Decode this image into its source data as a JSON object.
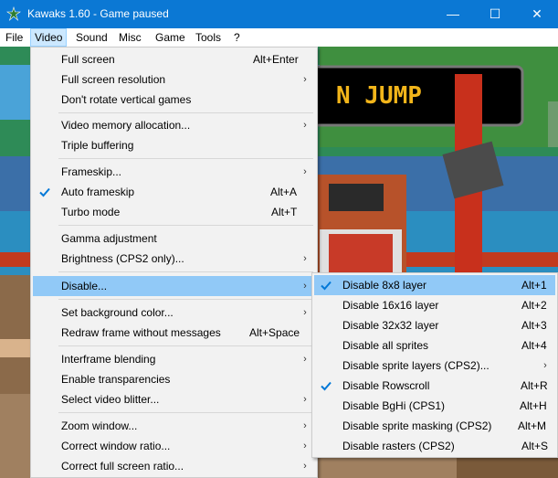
{
  "window": {
    "title": "Kawaks 1.60 - Game paused",
    "minimize_glyph": "—",
    "maximize_glyph": "☐",
    "close_glyph": "✕"
  },
  "menubar": [
    {
      "label": "File"
    },
    {
      "label": "Video"
    },
    {
      "label": "Sound"
    },
    {
      "label": "Misc"
    },
    {
      "label": "Game"
    },
    {
      "label": "Tools"
    },
    {
      "label": "?"
    }
  ],
  "game": {
    "banner_text": "N JUMP"
  },
  "video_menu": [
    {
      "label": "Full screen",
      "accel": "Alt+Enter"
    },
    {
      "label": "Full screen resolution",
      "submenu": true
    },
    {
      "label": "Don't rotate vertical games"
    },
    {
      "label": "Video memory allocation...",
      "submenu": true
    },
    {
      "label": "Triple buffering"
    },
    {
      "label": "Frameskip...",
      "submenu": true
    },
    {
      "label": "Auto frameskip",
      "accel": "Alt+A",
      "checked": true
    },
    {
      "label": "Turbo mode",
      "accel": "Alt+T"
    },
    {
      "label": "Gamma adjustment"
    },
    {
      "label": "Brightness (CPS2 only)...",
      "submenu": true
    },
    {
      "label": "Disable...",
      "submenu": true,
      "highlighted": true
    },
    {
      "label": "Set background color...",
      "submenu": true
    },
    {
      "label": "Redraw frame without messages",
      "accel": "Alt+Space"
    },
    {
      "label": "Interframe blending",
      "submenu": true
    },
    {
      "label": "Enable transparencies"
    },
    {
      "label": "Select video blitter...",
      "submenu": true
    },
    {
      "label": "Zoom window...",
      "submenu": true
    },
    {
      "label": "Correct window ratio...",
      "submenu": true
    },
    {
      "label": "Correct full screen ratio...",
      "submenu": true
    }
  ],
  "disable_menu": [
    {
      "label": "Disable 8x8 layer",
      "accel": "Alt+1",
      "checked": true,
      "highlighted": true
    },
    {
      "label": "Disable 16x16 layer",
      "accel": "Alt+2"
    },
    {
      "label": "Disable 32x32 layer",
      "accel": "Alt+3"
    },
    {
      "label": "Disable all sprites",
      "accel": "Alt+4"
    },
    {
      "label": "Disable sprite layers (CPS2)...",
      "submenu": true
    },
    {
      "label": "Disable Rowscroll",
      "accel": "Alt+R",
      "checked": true
    },
    {
      "label": "Disable BgHi (CPS1)",
      "accel": "Alt+H"
    },
    {
      "label": "Disable sprite masking (CPS2)",
      "accel": "Alt+M"
    },
    {
      "label": "Disable rasters (CPS2)",
      "accel": "Alt+S"
    }
  ],
  "icons": {
    "submenu_arrow": "›",
    "check": "check-icon"
  },
  "colors": {
    "titlebar": "#0b78d4",
    "menu_bg": "#f2f2f2",
    "highlight": "#91c9f7",
    "check_bg": "#0078d7"
  }
}
